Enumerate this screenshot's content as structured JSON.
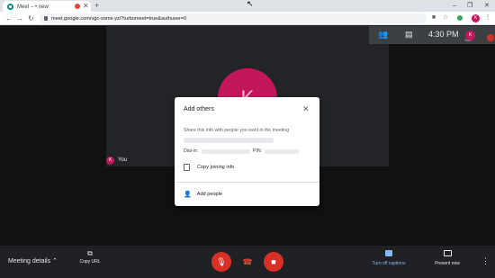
{
  "browser": {
    "tab_title": "Meet – • new",
    "tab_close": "✕",
    "new_tab": "+",
    "url": "meet.google.com/vgc-somx-yzi?turbomeet=true&authuser=0",
    "window_minimize": "–",
    "window_restore": "❐",
    "window_close": "✕",
    "profile_initial": "K"
  },
  "meeting": {
    "participant_initial": "K",
    "self_label": "You",
    "self_initial": "K",
    "clock": "4:30 PM",
    "you_mini_label": "You",
    "you_mini_initial": "K"
  },
  "dialog": {
    "title": "Add others",
    "description": "Share this info with people you want in the meeting",
    "dial_in_label": "Dial-in:",
    "pin_label": "PIN:",
    "copy_joining_info": "Copy joining info",
    "add_people": "Add people"
  },
  "bottom": {
    "meeting_details": "Meeting details",
    "copy_url": "Copy URL",
    "captions": "Turn off captions",
    "present_now": "Present now"
  },
  "colors": {
    "accent_red": "#d93025",
    "avatar": "#c2185b",
    "captions_blue": "#8ab4f8"
  }
}
